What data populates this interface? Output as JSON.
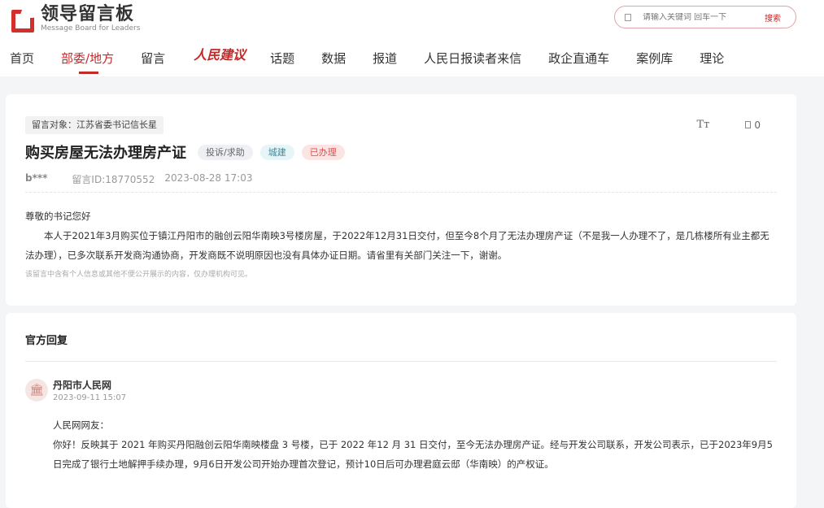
{
  "header": {
    "logo_title": "领导留言板",
    "logo_subtitle": "Message Board for Leaders",
    "search_placeholder": "请输入关键词 回车一下",
    "search_button": "搜索"
  },
  "nav": {
    "items": [
      "首页",
      "部委/地方",
      "留言",
      "人民建议",
      "话题",
      "数据",
      "报道",
      "人民日报读者来信",
      "政企直通车",
      "案例库",
      "理论"
    ],
    "active": "部委/地方"
  },
  "message": {
    "target": "留言对象：江苏省委书记信长星",
    "font_size_icon": "Tт",
    "like_count": "0",
    "title": "购买房屋无法办理房产证",
    "tags": [
      "投诉/求助",
      "城建",
      "已办理"
    ],
    "author": "b***",
    "id_text": "留言ID:18770552",
    "datetime": "2023-08-28 17:03",
    "greeting": "尊敬的书记您好",
    "content": "本人于2021年3月购买位于镇江丹阳市的融创云阳华南映3号楼房屋，于2022年12月31日交付，但至今8个月了无法办理房产证（不是我一人办理不了，是几栋楼所有业主都无法办理），已多次联系开发商沟通协商，开发商既不说明原因也没有具体办证日期。请省里有关部门关注一下，谢谢。",
    "privacy_note": "该留言中含有个人信息或其他不便公开展示的内容，仅办理机构可见。"
  },
  "reply": {
    "heading": "官方回复",
    "org_name": "丹阳市人民网",
    "time": "2023-09-11 15:07",
    "salutation": "人民网网友：",
    "content": "你好！反映其于 2021 年购买丹阳融创云阳华南映楼盘 3 号楼，已于 2022 年12 月 31 日交付，至今无法办理房产证。经与开发公司联系，开发公司表示，已于2023年9月5日完成了银行土地解押手续办理，9月6日开发公司开始办理首次登记，预计10日后可办理君庭云邸（华南映）的产权证。"
  },
  "colors": {
    "brand": "#c62828",
    "page_bg": "#f4f5f7"
  }
}
